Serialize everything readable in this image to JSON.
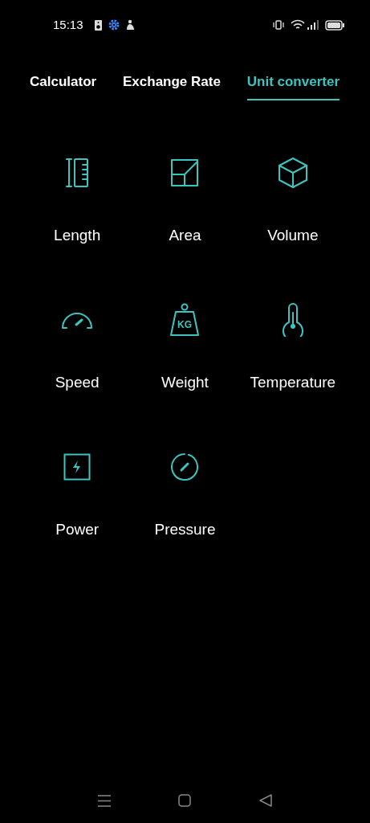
{
  "status_bar": {
    "time": "15:13"
  },
  "tabs": [
    {
      "label": "Calculator",
      "selected": false
    },
    {
      "label": "Exchange Rate",
      "selected": false
    },
    {
      "label": "Unit converter",
      "selected": true
    }
  ],
  "units": [
    {
      "kind": "length",
      "label": "Length"
    },
    {
      "kind": "area",
      "label": "Area"
    },
    {
      "kind": "volume",
      "label": "Volume"
    },
    {
      "kind": "speed",
      "label": "Speed"
    },
    {
      "kind": "weight",
      "label": "Weight",
      "icon_text": "KG"
    },
    {
      "kind": "temperature",
      "label": "Temperature"
    },
    {
      "kind": "power",
      "label": "Power"
    },
    {
      "kind": "pressure",
      "label": "Pressure"
    }
  ]
}
